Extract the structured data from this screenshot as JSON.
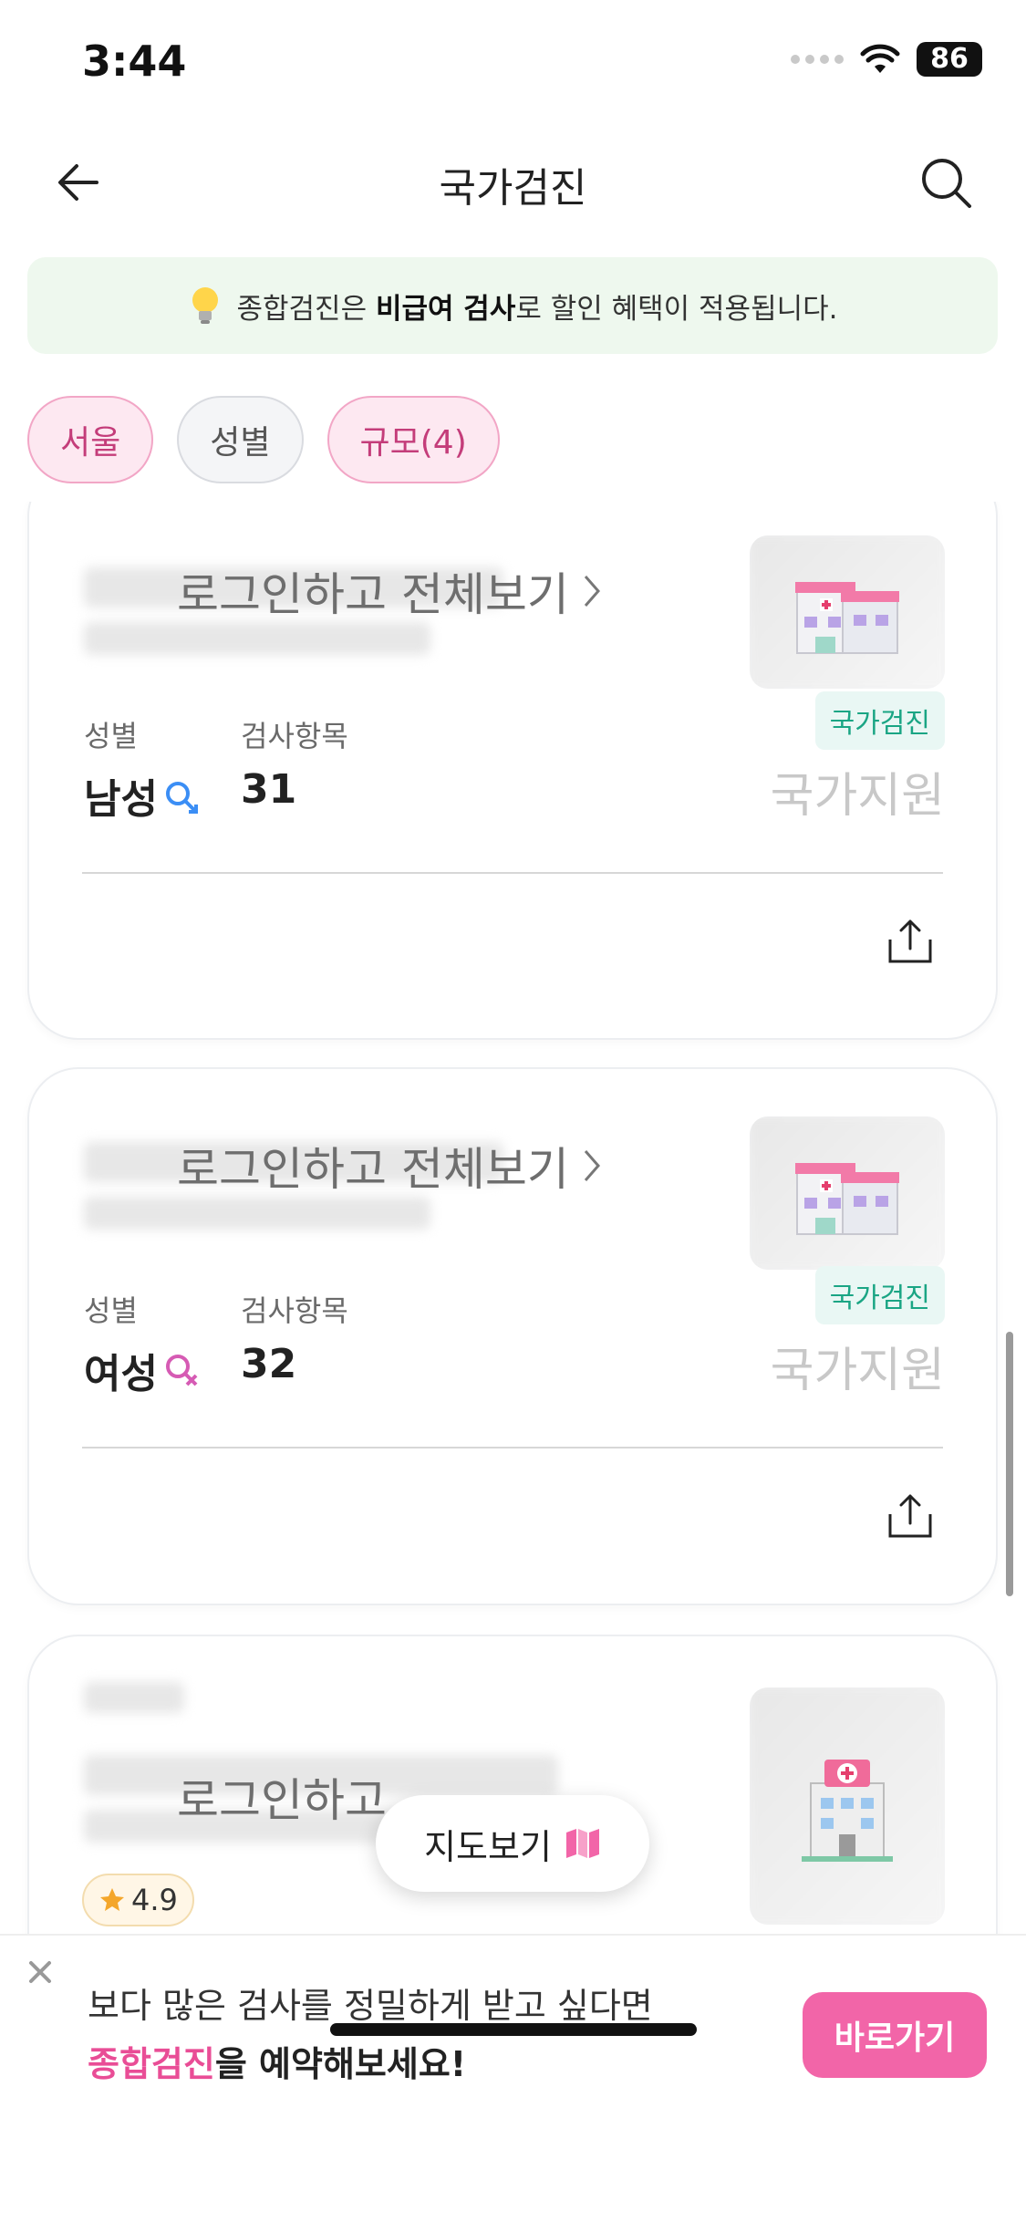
{
  "status_bar": {
    "time": "3:44",
    "battery": "86"
  },
  "header": {
    "title": "국가검진"
  },
  "notice": {
    "prefix": "종합검진은 ",
    "bold": "비급여 검사",
    "suffix": "로 할인 혜택이 적용됩니다."
  },
  "filters": [
    {
      "label": "서울",
      "active": true
    },
    {
      "label": "성별",
      "active": false
    },
    {
      "label": "규모(4)",
      "active": true
    }
  ],
  "cards": [
    {
      "login_text": "로그인하고 전체보기",
      "gender_label": "성별",
      "gender_value": "남성",
      "items_label": "검사항목",
      "items_value": "31",
      "tag": "국가검진",
      "support": "국가지원"
    },
    {
      "login_text": "로그인하고 전체보기",
      "gender_label": "성별",
      "gender_value": "여성",
      "items_label": "검사항목",
      "items_value": "32",
      "tag": "국가검진",
      "support": "국가지원"
    },
    {
      "login_text": "로그인하고 ",
      "rating": "4.9"
    }
  ],
  "map_button": {
    "label": "지도보기"
  },
  "banner": {
    "line1": "보다 많은 검사를 정밀하게 받고 싶다면",
    "line2_highlight": "종합검진",
    "line2_rest": "을 예약해보세요!",
    "button": "바로가기"
  },
  "colors": {
    "accent_pink": "#f265a8",
    "tag_green": "#1aa584",
    "male_blue": "#3b8ef5",
    "female_pink": "#d65bb4"
  }
}
